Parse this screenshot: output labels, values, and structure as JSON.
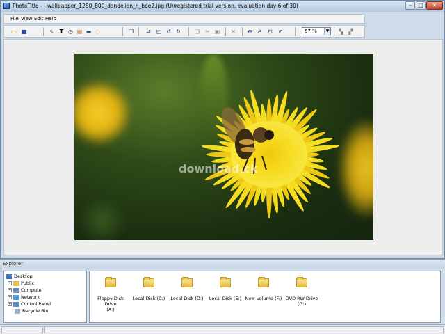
{
  "window": {
    "title": "PhotoTitle - - wallpapper_1280_800_dandelion_n_bee2.jpg (Unregistered trial version, evaluation day 6 of 30)"
  },
  "menu": {
    "items": [
      "File",
      "View",
      "Edit",
      "Help"
    ]
  },
  "toolbar": {
    "zoom_value": "57 %",
    "icons": [
      "open-icon",
      "save-icon",
      "select-icon",
      "text-icon",
      "clock-icon",
      "gradient-icon",
      "frame-icon",
      "balloon-icon",
      "copy-layer-icon",
      "line-icon",
      "resize-icon",
      "rotate-left-icon",
      "rotate-right-icon",
      "cut-copy-icon",
      "scissors-icon",
      "paste-icon",
      "delete-icon",
      "zoom-in-icon",
      "zoom-out-icon",
      "fit-icon",
      "zoom-actual-icon",
      "layer-up-icon",
      "layer-down-icon"
    ]
  },
  "canvas": {
    "watermark": "download.ck"
  },
  "explorer": {
    "label": "Explorer",
    "tree": [
      {
        "label": "Desktop",
        "icon": "desktop-icon",
        "expand": false,
        "indent": 0
      },
      {
        "label": "Public",
        "icon": "user-folder-icon",
        "expand": true,
        "indent": 1
      },
      {
        "label": "Computer",
        "icon": "computer-icon",
        "expand": true,
        "indent": 1
      },
      {
        "label": "Network",
        "icon": "network-icon",
        "expand": true,
        "indent": 1
      },
      {
        "label": "Control Panel",
        "icon": "control-panel-icon",
        "expand": true,
        "indent": 1
      },
      {
        "label": "Recycle Bin",
        "icon": "recycle-bin-icon",
        "expand": false,
        "indent": 1
      }
    ],
    "drives": [
      {
        "line1": "Floppy Disk Drive",
        "line2": "(A:)"
      },
      {
        "line1": "Local Disk (C:)",
        "line2": ""
      },
      {
        "line1": "Local Disk (D:)",
        "line2": ""
      },
      {
        "line1": "Local Disk (E:)",
        "line2": ""
      },
      {
        "line1": "New Volume (F:)",
        "line2": ""
      },
      {
        "line1": "DVD RW Drive",
        "line2": "(G:)"
      }
    ]
  }
}
